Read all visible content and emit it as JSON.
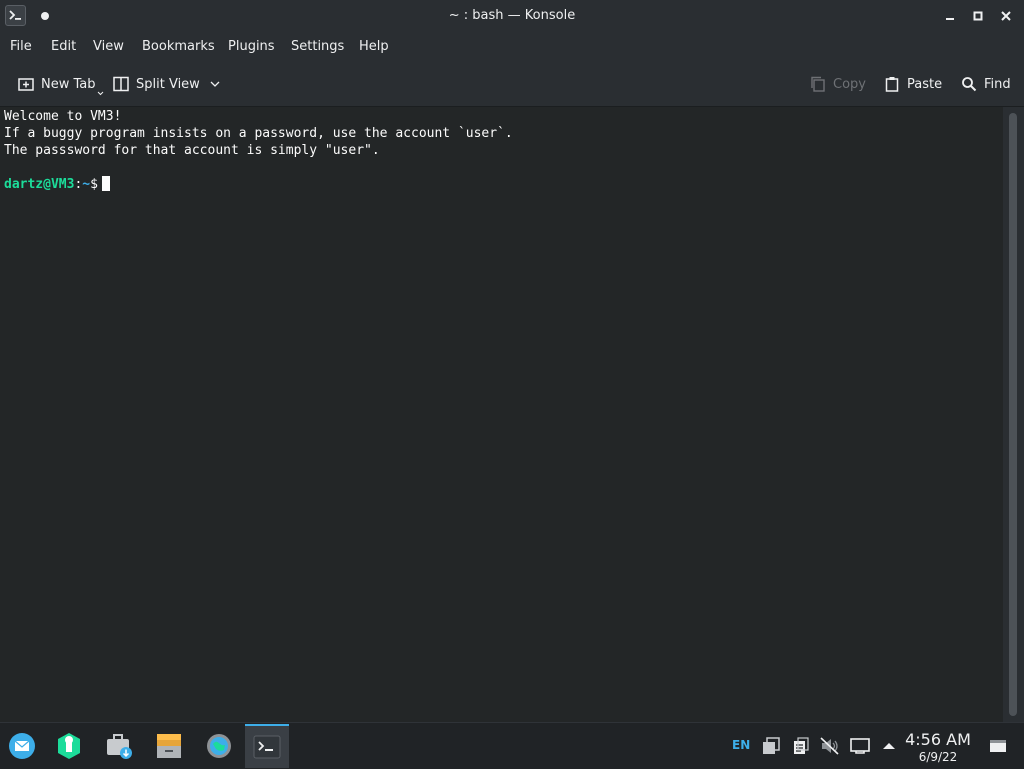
{
  "window": {
    "title": "~ : bash — Konsole"
  },
  "menu": {
    "items": [
      "File",
      "Edit",
      "View",
      "Bookmarks",
      "Plugins",
      "Settings",
      "Help"
    ]
  },
  "toolbar": {
    "new_tab": "New Tab",
    "split_view": "Split View",
    "copy": "Copy",
    "paste": "Paste",
    "find": "Find"
  },
  "terminal": {
    "lines": [
      "Welcome to VM3!",
      "If a buggy program insists on a password, use the account `user`.",
      "The passsword for that account is simply \"user\"."
    ],
    "prompt": {
      "user_host": "dartz@VM3",
      "separator": ":",
      "path": "~",
      "symbol": "$"
    }
  },
  "taskbar": {
    "apps": [
      "mail-icon",
      "discover-icon",
      "store-icon",
      "file-manager-icon",
      "settings-icon",
      "terminal-icon"
    ],
    "tray": {
      "language": "EN",
      "icons": [
        "clipboard-icon",
        "notes-icon",
        "volume-muted-icon",
        "network-icon",
        "expand-tray-icon"
      ]
    },
    "clock": {
      "time": "4:56 AM",
      "date": "6/9/22"
    }
  },
  "colors": {
    "accent": "#3daee9",
    "prompt_user": "#1cdc9a",
    "terminal_bg": "#232627"
  }
}
